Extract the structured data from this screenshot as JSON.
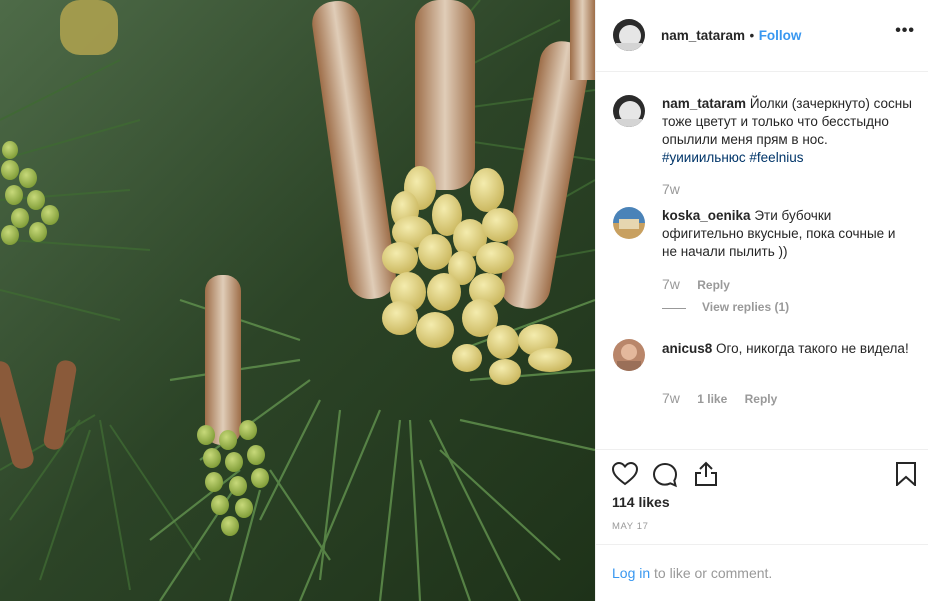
{
  "post": {
    "username": "nam_tataram",
    "follow_label": "Follow",
    "separator": "•",
    "more_icon": "more-horizontal-icon"
  },
  "comments": [
    {
      "username": "nam_tataram",
      "text": "Йолки (зачеркнуто) сосны тоже цветут и только что бесстыдно опылили меня прям в нос.",
      "hashtags": "#уиииильнюс #feelnius",
      "time": "7w"
    },
    {
      "username": "koska_oenika",
      "text": "Эти бубочки офигительно вкусные, пока сочные и не начали пылить ))",
      "time": "7w",
      "reply_label": "Reply",
      "view_replies": "View replies (1)"
    },
    {
      "username": "anicus8",
      "text": "Ого, никогда такого не видела!",
      "time": "7w",
      "likes_label": "1 like",
      "reply_label": "Reply"
    }
  ],
  "actions": {
    "like_icon": "heart-icon",
    "comment_icon": "comment-icon",
    "share_icon": "share-icon",
    "save_icon": "bookmark-icon",
    "likes": "114 likes",
    "date": "MAY 17"
  },
  "footer": {
    "login_link": "Log in",
    "login_text": "to like or comment."
  },
  "colors": {
    "link": "#3897f0",
    "hashtag": "#003569",
    "muted": "#999999",
    "border": "#efefef"
  }
}
